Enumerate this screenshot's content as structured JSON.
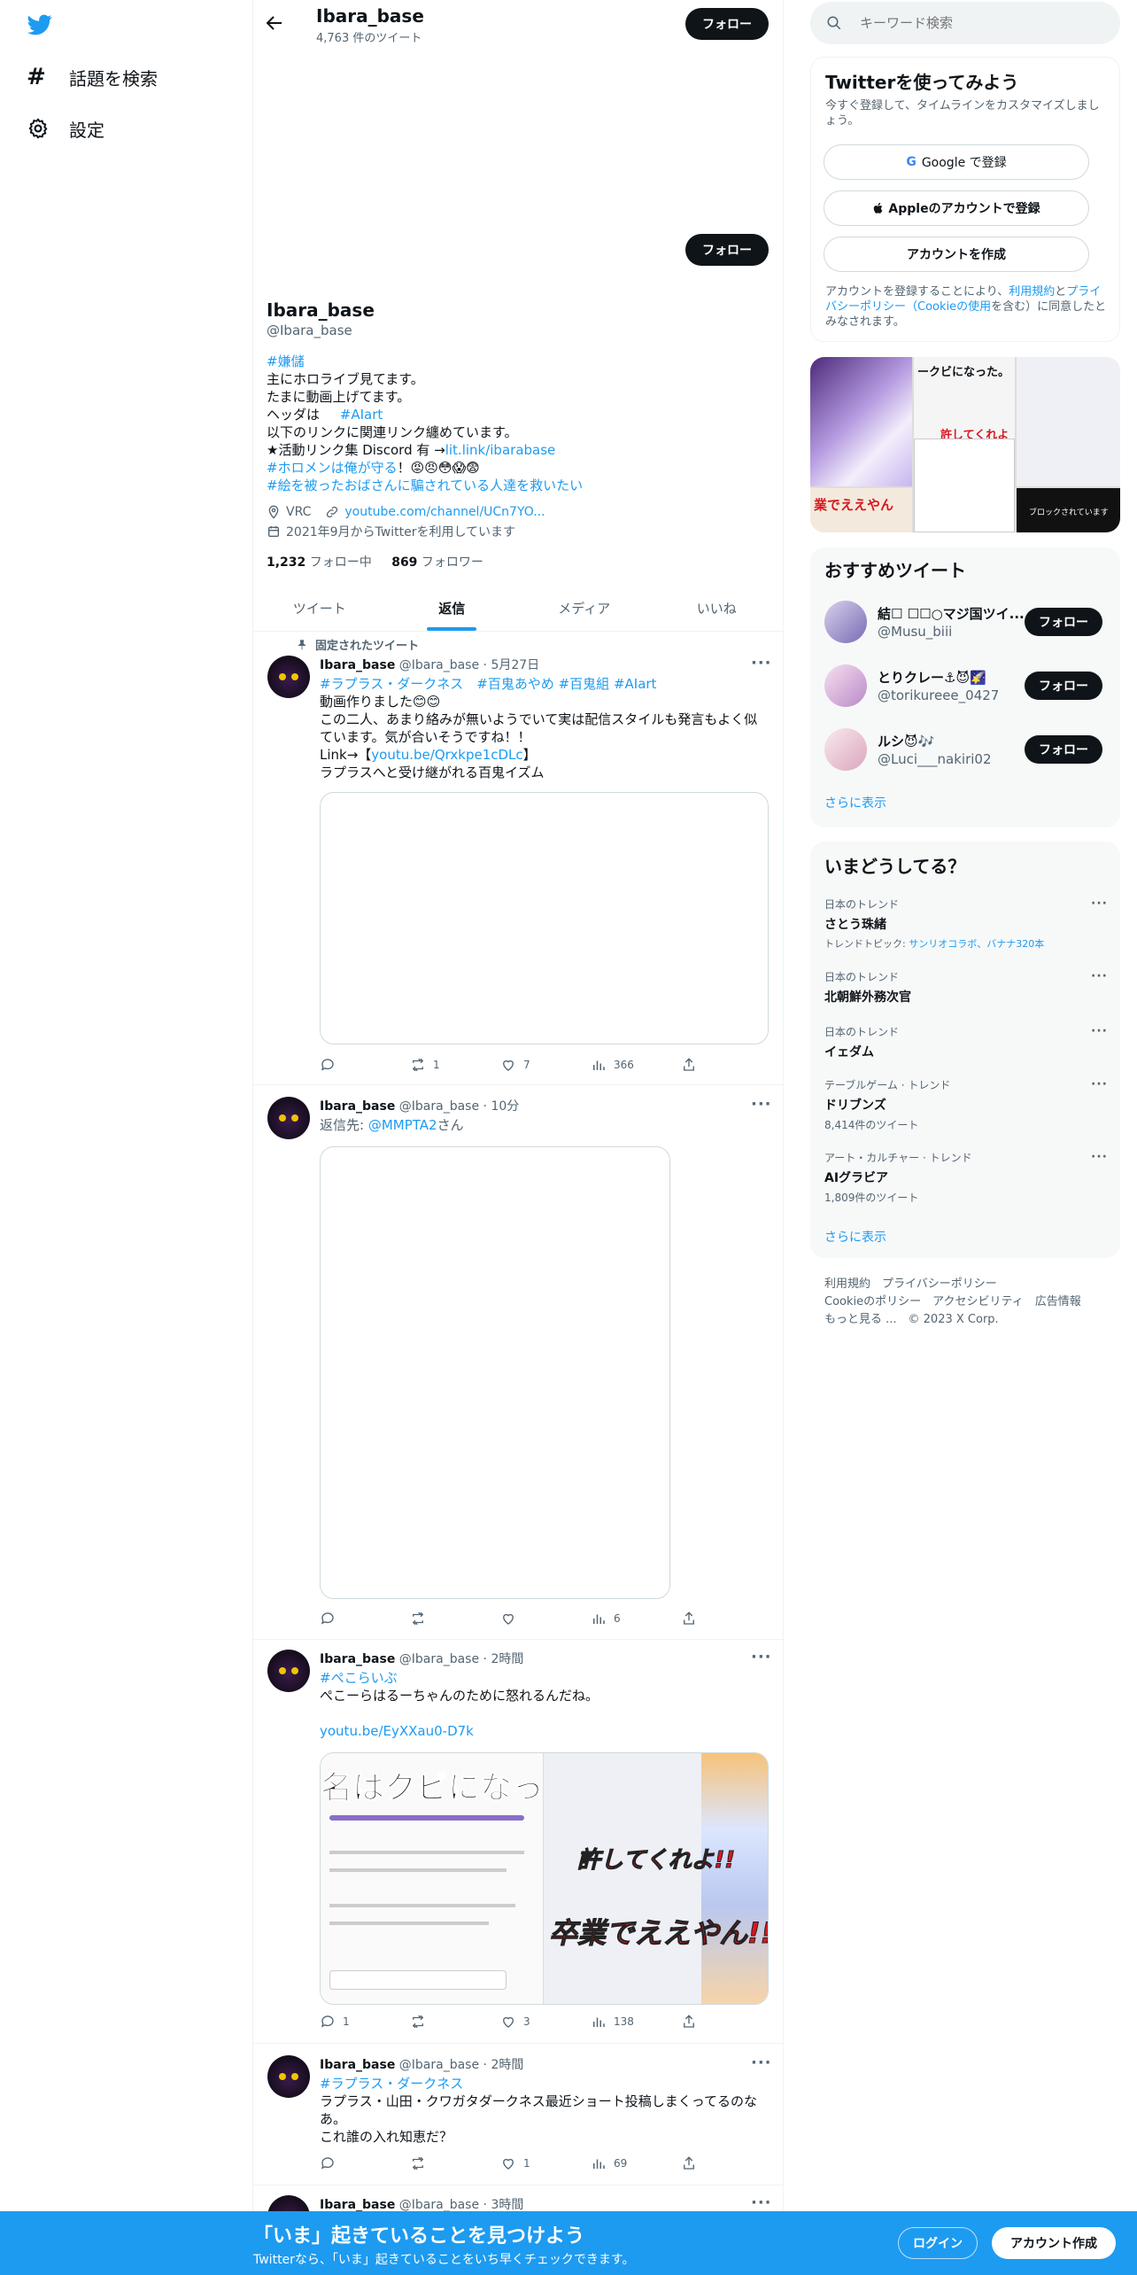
{
  "left_nav": {
    "explore": "話題を検索",
    "settings": "設定"
  },
  "header": {
    "name": "Ibara_base",
    "tweet_count": "4,763 件のツイート",
    "follow": "フォロー"
  },
  "profile": {
    "follow": "フォロー",
    "name": "Ibara_base",
    "handle": "@Ibara_base",
    "bio": {
      "l1": "#嫌儲",
      "l2": "主にホロライブ見てます。",
      "l3": "たまに動画上げてます。",
      "l4_pre": "ヘッダは ",
      "l4_tag": "#AIart",
      "l5": "以下のリンクに関連リンク纏めています。",
      "l6_pre": "★活動リンク集 Discord 有 →",
      "l6_link": "lit.link/ibarabase",
      "l7_tag": "#ホロメンは俺が守る",
      "l7_rest": "！😡😠😳😱😨",
      "l8": "#絵を被ったおばさんに騙されている人達を救いたい"
    },
    "location": "VRC",
    "url": "youtube.com/channel/UCn7YO...",
    "joined": "2021年9月からTwitterを利用しています",
    "following_count": "1,232",
    "following_label": " フォロー中",
    "followers_count": "869",
    "followers_label": " フォロワー"
  },
  "tabs": [
    "ツイート",
    "返信",
    "メディア",
    "いいね"
  ],
  "tweets": [
    {
      "pinned": "固定されたツイート",
      "name": "Ibara_base",
      "handle": "@Ibara_base",
      "time": "· 5月27日",
      "tags_line": "#ラプラス・ダークネス　#百鬼あやめ #百鬼組 #AIart",
      "t1": "動画作りました😊😊",
      "t2": "この二人、あまり絡みが無いようでいて実は配信スタイルも発言もよく似",
      "t3": "ています。気が合いそうですね！！",
      "t4_pre": "Link→【",
      "t4_link": "youtu.be/Qrxkpe1cDLc",
      "t4_post": "】",
      "t5": "ラプラスへと受け継がれる百鬼イズム",
      "reply": "",
      "retweet": "1",
      "like": "7",
      "views": "366"
    },
    {
      "name": "Ibara_base",
      "handle": "@Ibara_base",
      "time": "· 10分",
      "reply_to_pre": "返信先: ",
      "reply_to": "@MMPTA2",
      "reply_to_post": "さん",
      "reply": "",
      "retweet": "",
      "like": "",
      "views": "6"
    },
    {
      "name": "Ibara_base",
      "handle": "@Ibara_base",
      "time": "· 2時間",
      "tag": "#ぺこらいぶ",
      "text": "ぺこーらはるーちゃんのために怒れるんだね。",
      "link": "youtu.be/EyXXau0-D7k",
      "img_top": "名はクビになっ",
      "img_mid": "許してくれよ!!",
      "img_bot": "卒業でええやん!!",
      "reply": "1",
      "retweet": "",
      "like": "3",
      "views": "138"
    },
    {
      "name": "Ibara_base",
      "handle": "@Ibara_base",
      "time": "· 2時間",
      "tag": "#ラプラス・ダークネス",
      "t1": "ラプラス・山田・クワガタダークネス最近ショート投稿しまくってるのな",
      "t2": "あ。",
      "t3": "これ誰の入れ知恵だ？",
      "reply": "",
      "retweet": "",
      "like": "1",
      "views": "69"
    },
    {
      "name": "Ibara_base",
      "handle": "@Ibara_base",
      "time": "· 3時間"
    }
  ],
  "search": {
    "placeholder": "キーワード検索"
  },
  "signup": {
    "title": "Twitterを使ってみよう",
    "subtitle": "今すぐ登録して、タイムラインをカスタマイズしましょう。",
    "google": "Google で登録",
    "apple": "Appleのアカウントで登録",
    "create": "アカウントを作成",
    "terms1": "アカウントを登録することにより、",
    "terms_link1": "利用規約",
    "terms2": "と",
    "terms_link2": "プライバシーポリシー（Cookieの使用",
    "terms3": "を含む）に同意したとみなされます。"
  },
  "media_grid": {
    "t1": "ークビになった。",
    "t2": "許してくれよ",
    "t3": "業でええやん",
    "t4": "ブロックされています"
  },
  "recommended": {
    "title": "おすすめツイート",
    "users": [
      {
        "name": "結☐ ☐☐○マジ国ツイ...",
        "handle": "@Musu_biii",
        "follow": "フォロー"
      },
      {
        "name": "とりクレー⚓😈🌠",
        "handle": "@torikureee_0427",
        "follow": "フォロー"
      },
      {
        "name": "ルシ😈🎶",
        "handle": "@Luci___nakiri02",
        "follow": "フォロー"
      }
    ],
    "more": "さらに表示"
  },
  "trends": {
    "title": "いまどうしてる？",
    "items": [
      {
        "ctx": "日本のトレンド",
        "name": "さとう珠緒",
        "sub_pre": "トレンドトピック: ",
        "sub_link": "サンリオコラボ、バナナ320本"
      },
      {
        "ctx": "日本のトレンド",
        "name": "北朝鮮外務次官"
      },
      {
        "ctx": "日本のトレンド",
        "name": "イェダム"
      },
      {
        "ctx": "テーブルゲーム · トレンド",
        "name": "ドリブンズ",
        "count": "8,414件のツイート"
      },
      {
        "ctx": "アート・カルチャー · トレンド",
        "name": "AIグラビア",
        "count": "1,809件のツイート"
      }
    ],
    "more": "さらに表示"
  },
  "footer": {
    "l1": "利用規約　プライバシーポリシー",
    "l2": "Cookieのポリシー　アクセシビリティ　広告情報",
    "l3": "もっと見る ...　© 2023 X Corp."
  },
  "bottom_bar": {
    "title": "「いま」起きていることを見つけよう",
    "subtitle": "Twitterなら、「いま」起きていることをいち早くチェックできます。",
    "login": "ログイン",
    "signup": "アカウント作成"
  },
  "colors": {
    "accent": "#1d9bf0",
    "dark": "#0f1419",
    "muted": "#536471"
  }
}
